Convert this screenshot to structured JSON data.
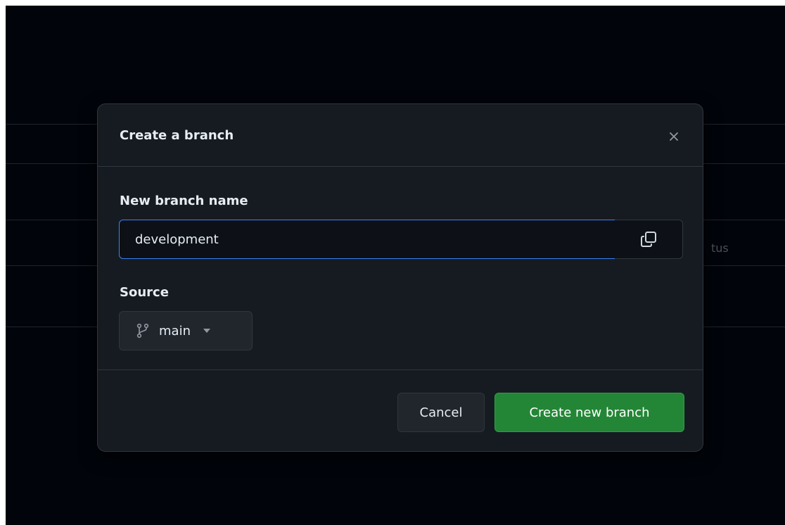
{
  "background": {
    "partial_column_header": "tus"
  },
  "dialog": {
    "title": "Create a branch",
    "close_icon": "x-icon",
    "branch_name": {
      "label": "New branch name",
      "value": "development",
      "copy_icon": "copy-icon"
    },
    "source": {
      "label": "Source",
      "branch": "main",
      "branch_icon": "git-branch-icon",
      "dropdown_icon": "triangle-down-icon"
    },
    "buttons": {
      "cancel": "Cancel",
      "create": "Create new branch"
    }
  },
  "colors": {
    "backdrop": "#01040a",
    "dialog_bg": "#161b22",
    "border": "#30363d",
    "text": "#e6edf3",
    "focus_border": "#3a82f6",
    "primary_button": "#238636"
  }
}
